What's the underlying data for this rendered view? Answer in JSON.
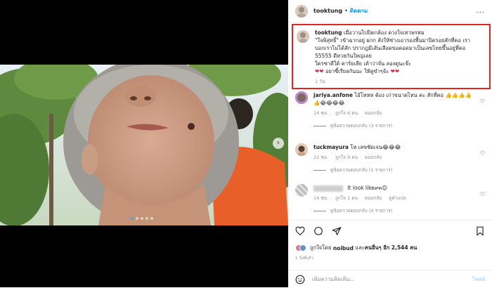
{
  "colors": {
    "accent": "#0095f6",
    "highlight_border": "#e02323",
    "heart": "#e0243a",
    "muted": "#8e8e8e"
  },
  "media": {
    "slide_count": 5,
    "active_slide": 1,
    "next_icon": "chevron-right-icon"
  },
  "header": {
    "username": "tooktung",
    "separator": "•",
    "follow_label": "ติดตาม",
    "more_icon": "ellipsis-icon",
    "more_label": "..."
  },
  "caption": {
    "username": "tooktung",
    "lines": [
      "เมื่อวานไปปิดกล้อง ดวงใจเทวพรหม",
      "\"ใจพิสุทธิ์\" เข้าฉากอยู่ ผกก สั่งให้ช่างเอารองพื้นมาปิดรอยสักที่คอ เรา",
      "บอกเราไม่ได้สัก ปรากฎมีเส้นเลือดขอดอดมาเป็นเลขไทยขึ้นอยู่ที่คอ",
      "55555 ดีหวยกันใหญ่เลย",
      "ใครซาดีใด้ คาร์ยเลีย เค้าว่าจั่น ลองดูนะจ๊ะ",
      "อยาซี้เรียลกันนะ ให้ดูขำๆจ้ะ"
    ],
    "hearts_prefix": "❤❤",
    "hearts_suffix": "❤❤",
    "time": "1 วัน"
  },
  "comments": [
    {
      "username": "jariya.anfone",
      "text": "ไอ้โหหห ต้อง เก่าขนาดไหน คะ สักที่คอ 👍👍👍👍",
      "text2": "👍😂😂😂😂",
      "likes": "ถูกใจ 6 คน",
      "time": "14 ชม.",
      "reply": "ตอบกลับ",
      "replies": "ดูข้อความตอบกลับ (3 รายการ)",
      "heart_icon": "heart-outline-icon",
      "heart_label": "♡"
    },
    {
      "username": "tuckmayura",
      "text": "โห เลขชัดเจน😂😂😂",
      "likes": "ถูกใจ 9 คน",
      "time": "22 ชม.",
      "reply": "ตอบกลับ",
      "replies": "ดูข้อความตอบกลับ (1 รายการ)",
      "heart_icon": "heart-outline-icon",
      "heart_label": "♡"
    },
    {
      "username": "",
      "text": "It look like๙๓😊",
      "likes": "ถูกใจ 1 คน",
      "time": "14 ชม.",
      "reply": "ตอบกลับ",
      "translate": "ดูคำแปล",
      "replies": "ดูข้อความตอบกลับ (4 รายการ)",
      "heart_icon": "heart-outline-icon",
      "heart_label": "♡"
    }
  ],
  "actions": {
    "like_icon": "heart-outline-icon",
    "comment_icon": "comment-bubble-icon",
    "share_icon": "paper-plane-icon",
    "save_icon": "bookmark-icon"
  },
  "likes": {
    "prefix": "ถูกใจโดย",
    "user": "noibud",
    "middle": "และ",
    "others": "คนอื่นๆ อีก 2,544 คน"
  },
  "post_date": "1 วันที่แล้ว",
  "add_comment": {
    "emoji_icon": "smiley-icon",
    "placeholder": "เพิ่มความคิดเห็น...",
    "post_label": "โพสต์"
  }
}
